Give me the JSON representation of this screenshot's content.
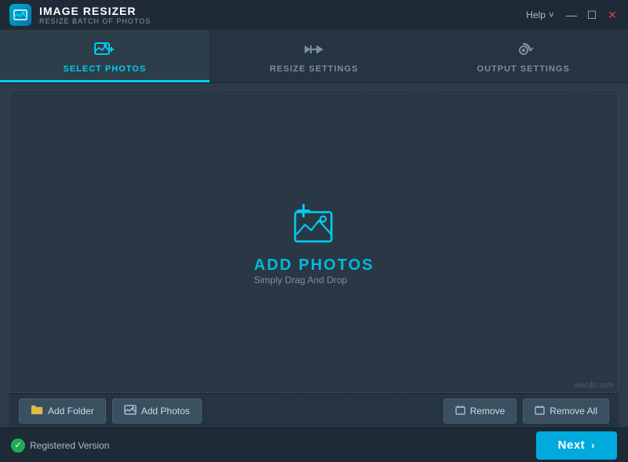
{
  "titleBar": {
    "appName": "IMAGE RESIZER",
    "appSubtitle": "RESIZE BATCH OF PHOTOS",
    "helpLabel": "Help",
    "chevron": "˅",
    "minimizeBtn": "—",
    "maximizeBtn": "☐",
    "closeBtn": "✕"
  },
  "tabs": [
    {
      "id": "select-photos",
      "label": "SELECT PHOTOS",
      "active": true
    },
    {
      "id": "resize-settings",
      "label": "RESIZE SETTINGS",
      "active": false
    },
    {
      "id": "output-settings",
      "label": "OUTPUT SETTINGS",
      "active": false
    }
  ],
  "dropZone": {
    "addPhotosLabel": "ADD PHOTOS",
    "dragDropLabel": "Simply Drag And Drop"
  },
  "toolbar": {
    "addFolderLabel": "Add Folder",
    "addPhotosLabel": "Add Photos",
    "removeLabel": "Remove",
    "removeAllLabel": "Remove All"
  },
  "footer": {
    "registeredLabel": "Registered Version",
    "nextLabel": "Next"
  },
  "watermark": "wscdn.com"
}
